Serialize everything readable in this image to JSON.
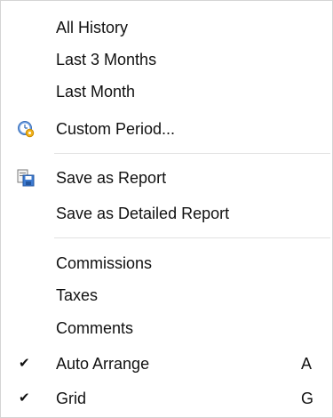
{
  "menu": {
    "items": [
      {
        "label": "All History"
      },
      {
        "label": "Last 3 Months"
      },
      {
        "label": "Last Month"
      },
      {
        "label": "Custom Period...",
        "icon": "clock-gear-icon"
      },
      {
        "label": "Save as Report",
        "icon": "save-report-icon"
      },
      {
        "label": "Save as Detailed Report"
      },
      {
        "label": "Commissions"
      },
      {
        "label": "Taxes"
      },
      {
        "label": "Comments"
      },
      {
        "label": "Auto Arrange",
        "checked": true,
        "shortcut": "A"
      },
      {
        "label": "Grid",
        "checked": true,
        "shortcut": "G"
      }
    ],
    "check_glyph": "✔",
    "accent_colors": {
      "clock_face": "#5a8fd6",
      "gear": "#f2b21a",
      "disk": "#3d7bd2"
    }
  }
}
